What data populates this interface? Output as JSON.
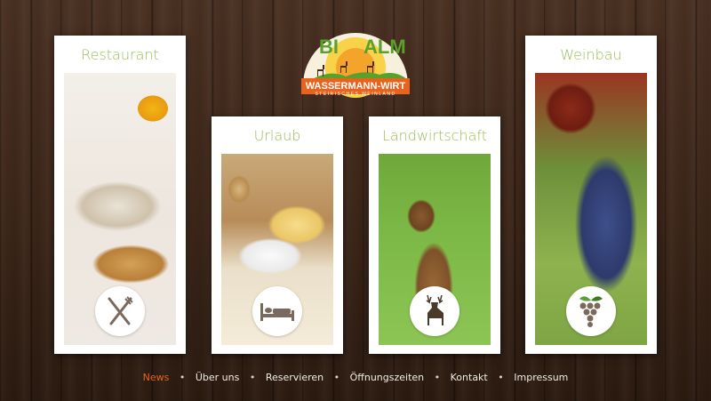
{
  "logo": {
    "top_text_left": "BI",
    "top_text_right": "ALM",
    "main_text": "WASSERMANN-WIRT",
    "sub_text": "STEIRISCHES WEINLAND"
  },
  "panels": [
    {
      "title": "Restaurant",
      "icon": "fork-knife-icon"
    },
    {
      "title": "Urlaub",
      "icon": "bed-icon"
    },
    {
      "title": "Landwirtschaft",
      "icon": "deer-icon"
    },
    {
      "title": "Weinbau",
      "icon": "grapes-icon"
    }
  ],
  "nav": {
    "items": [
      "News",
      "Über uns",
      "Reservieren",
      "Öffnungszeiten",
      "Kontakt",
      "Impressum"
    ],
    "active": "News",
    "separator": "•"
  },
  "colors": {
    "title_green": "#9cbd54",
    "nav_active": "#e8641e",
    "logo_orange": "#e8641e",
    "logo_green": "#5aa02c"
  }
}
